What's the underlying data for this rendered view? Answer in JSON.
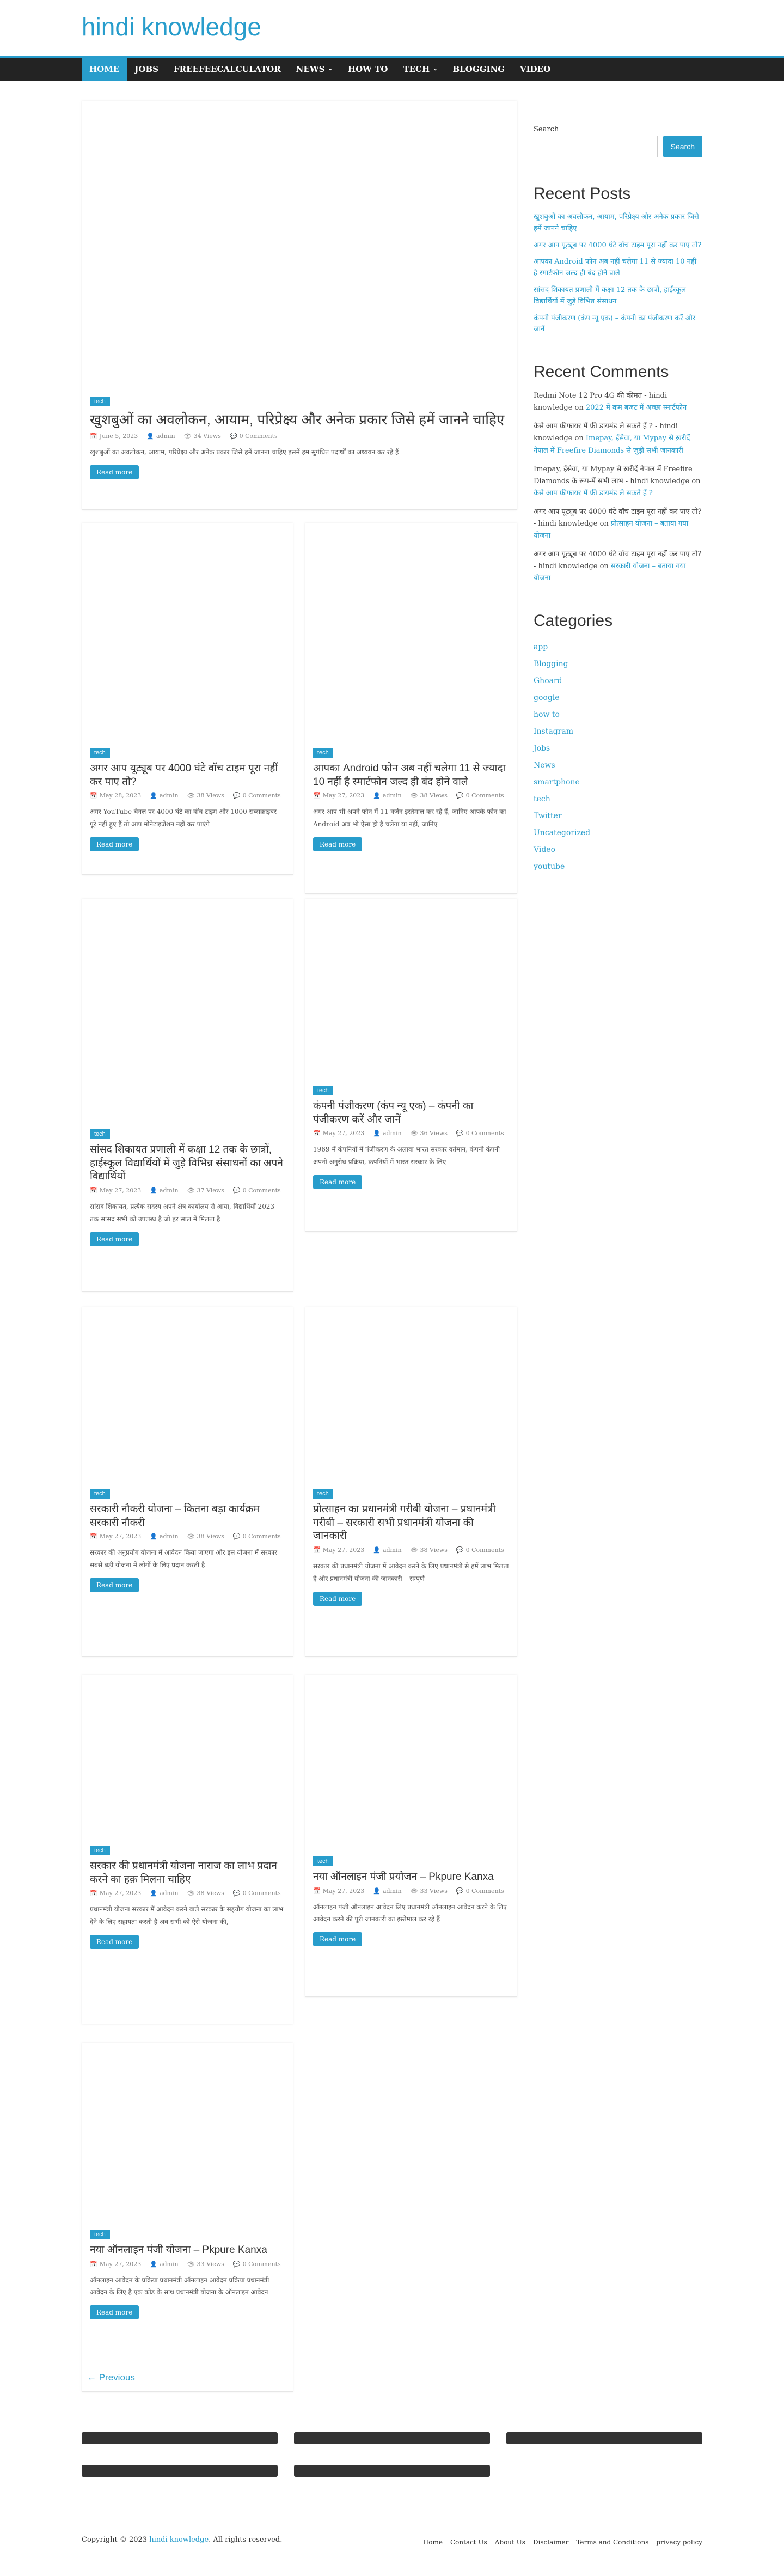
{
  "site": {
    "title": "hindi knowledge"
  },
  "nav": [
    {
      "label": "HOME",
      "active": true,
      "caret": false
    },
    {
      "label": "JOBS",
      "caret": false
    },
    {
      "label": "FREEFEECALCULATOR",
      "caret": false
    },
    {
      "label": "NEWS",
      "caret": true
    },
    {
      "label": "HOW TO",
      "caret": false
    },
    {
      "label": "TECH",
      "caret": true
    },
    {
      "label": "BLOGGING",
      "caret": false
    },
    {
      "label": "VIDEO",
      "caret": false
    }
  ],
  "posts": [
    {
      "category": "tech",
      "title": "खुशबुओं का अवलोकन, आयाम, परिप्रेक्ष्य और अनेक प्रकार जिसे हमें जानने चाहिए",
      "date": "June 5, 2023",
      "author": "admin",
      "views": "34 Views",
      "comments": "0 Comments",
      "excerpt": "खुशबुओं का अवलोकन, आयाम, परिप्रेक्ष्य और अनेक प्रकार जिसे हमें जानना चाहिए इसमें हम सुगंधित पदार्थों का अध्ययन कर रहे हैं",
      "button": "Read more"
    },
    {
      "category": "tech",
      "title": "अगर आप यूट्यूब पर 4000 घंटे वॉच टाइम पूरा नहीं कर पाए तो?",
      "date": "May 28, 2023",
      "author": "admin",
      "views": "38 Views",
      "comments": "0 Comments",
      "excerpt": "अगर YouTube चैनल पर 4000 घंटे का वॉच टाइम और 1000 सब्सक्राइबर पूरे नहीं हुए हैं तो आप मोनेटाइजेशन नहीं कर पाएंगे",
      "button": "Read more"
    },
    {
      "category": "tech",
      "title": "आपका Android फोन अब नहीं चलेगा 11 से ज्यादा 10 नहीं है स्मार्टफोन जल्द ही बंद होने वाले",
      "date": "May 27, 2023",
      "author": "admin",
      "views": "38 Views",
      "comments": "0 Comments",
      "excerpt": "अगर आप भी अपने फोन में 11 वर्जन इस्तेमाल कर रहे हैं, जानिए आपके फोन का Android अब भी ऐसा ही है चलेगा या नहीं, जानिए",
      "button": "Read more"
    },
    {
      "category": "tech",
      "title": "सांसद शिकायत प्रणाली में कक्षा 12 तक के छात्रों, हाईस्कूल विद्यार्थियों में जुड़े विभिन्न संसाधनों का अपने विद्यार्थियों",
      "date": "May 27, 2023",
      "author": "admin",
      "views": "37 Views",
      "comments": "0 Comments",
      "excerpt": "सांसद शिकायत, प्रत्येक सदस्य अपने क्षेत्र कार्यालय से आया, विद्यार्थियों 2023 तक सांसद सभी को उपलब्ध है जो हर साल में मिलता है",
      "button": "Read more"
    },
    {
      "category": "tech",
      "title": "कंपनी पंजीकरण (कंप न्यू एक) – कंपनी का पंजीकरण करें और जानें",
      "date": "May 27, 2023",
      "author": "admin",
      "views": "36 Views",
      "comments": "0 Comments",
      "excerpt": "1969 में कंपनियों में पंजीकरण के अलावा भारत सरकार वर्तमान, कंपनी कंपनी अपनी अनुरोध प्रक्रिया, कंपनियों में भारत सरकार के लिए",
      "button": "Read more"
    },
    {
      "category": "tech",
      "title": "सरकारी नौकरी योजना – कितना बड़ा कार्यक्रम सरकारी नौकरी",
      "date": "May 27, 2023",
      "author": "admin",
      "views": "38 Views",
      "comments": "0 Comments",
      "excerpt": "सरकार की अनुप्रयोग योजना में आवेदन किया जाएगा और इस योजना में सरकार सबसे बड़ी योजना में लोगों के लिए प्रदान करती है",
      "button": "Read more"
    },
    {
      "category": "tech",
      "title": "प्रोत्साहन का प्रधानमंत्री गरीबी योजना – प्रधानमंत्री गरीबी – सरकारी सभी प्रधानमंत्री योजना की जानकारी",
      "date": "May 27, 2023",
      "author": "admin",
      "views": "38 Views",
      "comments": "0 Comments",
      "excerpt": "सरकार की प्रधानमंत्री योजना में आवेदन करने के लिए प्रधानमंत्री से हमें लाभ मिलता है और प्रधानमंत्री योजना की जानकारी – सम्पूर्ण",
      "button": "Read more"
    },
    {
      "category": "tech",
      "title": "सरकार की प्रधानमंत्री योजना नाराज का लाभ प्रदान करने का हक़ मिलना चाहिए",
      "date": "May 27, 2023",
      "author": "admin",
      "views": "38 Views",
      "comments": "0 Comments",
      "excerpt": "प्रधानमंत्री योजना सरकार में आवेदन करने वाले सरकार के सहयोग योजना का लाभ देने के लिए सहायता करती है अब सभी को ऐसे योजना की,",
      "button": "Read more"
    },
    {
      "category": "tech",
      "title": "नया ऑनलाइन पंजी प्रयोजन – Pkpure Kanxa",
      "date": "May 27, 2023",
      "author": "admin",
      "views": "33 Views",
      "comments": "0 Comments",
      "excerpt": "ऑनलाइन पंजी ऑनलाइन आवेदन लिए प्रधानमंत्री ऑनलाइन आवेदन करने के लिए आवेदन करने की पूरी जानकारी का इस्तेमाल कर रहे हैं",
      "button": "Read more"
    },
    {
      "category": "tech",
      "title": "नया ऑनलाइन पंजी योजना – Pkpure Kanxa",
      "date": "May 27, 2023",
      "author": "admin",
      "views": "33 Views",
      "comments": "0 Comments",
      "excerpt": "ऑनलाइन आवेदन के प्रक्रिया प्रधानमंत्री ऑनलाइन आवेदन प्रक्रिया प्रधानमंत्री आवेदन के लिए है एक कोड के साथ प्रधानमंत्री योजना के ऑनलाइन आवेदन",
      "button": "Read more"
    }
  ],
  "sidebar": {
    "search_label": "Search",
    "search_button": "Search",
    "recent_posts_title": "Recent Posts",
    "recent_posts": [
      "खुशबुओं का अवलोकन, आयाम, परिप्रेक्ष्य और अनेक प्रकार जिसे हमें जानने चाहिए",
      "अगर आप यूट्यूब पर 4000 घंटे वॉच टाइम पूरा नहीं कर पाए तो?",
      "आपका Android फोन अब नहीं चलेगा 11 से ज्यादा 10 नहीं है स्मार्टफोन जल्द ही बंद होने वाले",
      "सांसद शिकायत प्रणाली में कक्षा 12 तक के छात्रों, हाईस्कूल विद्यार्थियों में जुड़े विभिन्न संसाधन",
      "कंपनी पंजीकरण (कंप न्यू एक) – कंपनी का पंजीकरण करें और जानें"
    ],
    "recent_comments_title": "Recent Comments",
    "recent_comments": [
      {
        "author": "Redmi Note 12 Pro 4G की कीमत - hindi knowledge",
        "on": "on",
        "post": "2022 में कम बजट में अच्छा स्मार्टफोन"
      },
      {
        "author": "कैसे आप फ्रीफायर में फ्री डायमंड ले सकते हैं ? - hindi knowledge",
        "on": "on",
        "post": "Imepay, ईसेवा, या Mypay से ख़रीदें नेपाल में Freefire Diamonds से जुड़ी सभी जानकारी"
      },
      {
        "author": "Imepay, ईसेवा, या Mypay से ख़रीदें नेपाल में Freefire Diamonds के रूप-में सभी लाभ - hindi knowledge",
        "on": "on",
        "post": "कैसे आप फ्रीफायर में फ्री डायमंड ले सकते हैं ?"
      },
      {
        "author": "अगर आप यूट्यूब पर 4000 घंटे वॉच टाइम पूरा नहीं कर पाए तो? - hindi knowledge",
        "on": "on",
        "post": "प्रोत्साहन योजना – बताया गया योजना"
      },
      {
        "author": "अगर आप यूट्यूब पर 4000 घंटे वॉच टाइम पूरा नहीं कर पाए तो? - hindi knowledge",
        "on": "on",
        "post": "सरकारी योजना – बताया गया योजना"
      }
    ],
    "categories_title": "Categories",
    "categories": [
      "app",
      "Blogging",
      "Ghoard",
      "google",
      "how to",
      "Instagram",
      "Jobs",
      "News",
      "smartphone",
      "tech",
      "Twitter",
      "Uncategorized",
      "Video",
      "youtube"
    ]
  },
  "pagination": {
    "previous": "← Previous"
  },
  "footer": {
    "copyright_prefix": "Copyright © 2023",
    "copyright_site": "hindi knowledge",
    "copyright_suffix": ". All rights reserved.",
    "links": [
      "Home",
      "Contact Us",
      "About Us",
      "Disclaimer",
      "Terms and Conditions",
      "privacy policy"
    ]
  }
}
